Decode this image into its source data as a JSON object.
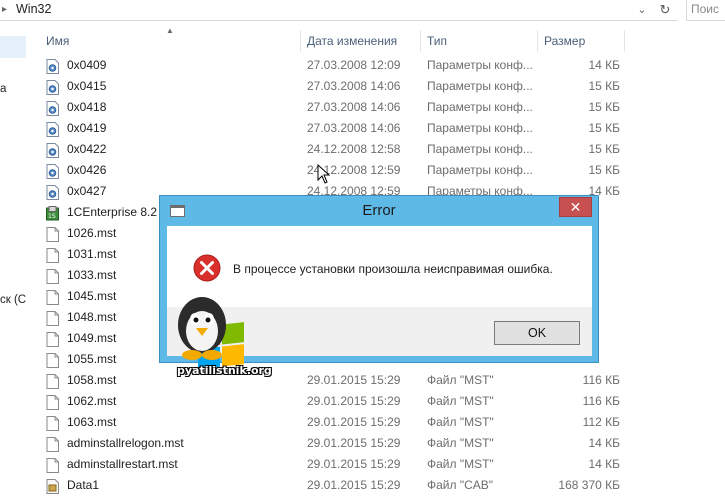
{
  "address_bar": {
    "path": "Win32",
    "search_placeholder": "Поис"
  },
  "nav": {
    "fragments": [
      "а",
      "ск (С"
    ]
  },
  "columns": {
    "name": "Имя",
    "date": "Дата изменения",
    "type": "Тип",
    "size": "Размер"
  },
  "files": [
    {
      "name": "0x0409",
      "date": "27.03.2008 12:09",
      "type": "Параметры конф...",
      "size": "14 КБ",
      "icon": "config-file-icon"
    },
    {
      "name": "0x0415",
      "date": "27.03.2008 14:06",
      "type": "Параметры конф...",
      "size": "15 КБ",
      "icon": "config-file-icon"
    },
    {
      "name": "0x0418",
      "date": "27.03.2008 14:06",
      "type": "Параметры конф...",
      "size": "15 КБ",
      "icon": "config-file-icon"
    },
    {
      "name": "0x0419",
      "date": "27.03.2008 14:06",
      "type": "Параметры конф...",
      "size": "15 КБ",
      "icon": "config-file-icon"
    },
    {
      "name": "0x0422",
      "date": "24.12.2008 12:58",
      "type": "Параметры конф...",
      "size": "15 КБ",
      "icon": "config-file-icon"
    },
    {
      "name": "0x0426",
      "date": "24.12.2008 12:59",
      "type": "Параметры конф...",
      "size": "15 КБ",
      "icon": "config-file-icon"
    },
    {
      "name": "0x0427",
      "date": "24.12.2008 12:59",
      "type": "Параметры конф...",
      "size": "14 КБ",
      "icon": "config-file-icon"
    },
    {
      "name": "1CEnterprise 8.2",
      "date": "",
      "type": "",
      "size": "",
      "icon": "installer-package-icon"
    },
    {
      "name": "1026.mst",
      "date": "",
      "type": "",
      "size": "",
      "icon": "document-icon"
    },
    {
      "name": "1031.mst",
      "date": "",
      "type": "",
      "size": "",
      "icon": "document-icon"
    },
    {
      "name": "1033.mst",
      "date": "",
      "type": "",
      "size": "",
      "icon": "document-icon"
    },
    {
      "name": "1045.mst",
      "date": "",
      "type": "",
      "size": "",
      "icon": "document-icon"
    },
    {
      "name": "1048.mst",
      "date": "",
      "type": "",
      "size": "",
      "icon": "document-icon"
    },
    {
      "name": "1049.mst",
      "date": "",
      "type": "",
      "size": "",
      "icon": "document-icon"
    },
    {
      "name": "1055.mst",
      "date": "",
      "type": "",
      "size": "",
      "icon": "document-icon"
    },
    {
      "name": "1058.mst",
      "date": "29.01.2015 15:29",
      "type": "Файл \"MST\"",
      "size": "116 КБ",
      "icon": "document-icon"
    },
    {
      "name": "1062.mst",
      "date": "29.01.2015 15:29",
      "type": "Файл \"MST\"",
      "size": "116 КБ",
      "icon": "document-icon"
    },
    {
      "name": "1063.mst",
      "date": "29.01.2015 15:29",
      "type": "Файл \"MST\"",
      "size": "112 КБ",
      "icon": "document-icon"
    },
    {
      "name": "adminstallrelogon.mst",
      "date": "29.01.2015 15:29",
      "type": "Файл \"MST\"",
      "size": "14 КБ",
      "icon": "document-icon"
    },
    {
      "name": "adminstallrestart.mst",
      "date": "29.01.2015 15:29",
      "type": "Файл \"MST\"",
      "size": "14 КБ",
      "icon": "document-icon"
    },
    {
      "name": "Data1",
      "date": "29.01.2015 15:29",
      "type": "Файл \"CAB\"",
      "size": "168 370 КБ",
      "icon": "cab-archive-icon"
    }
  ],
  "dialog": {
    "title": "Error",
    "message": "В процессе установки произошла неисправимая ошибка.",
    "ok_label": "OK",
    "close_glyph": "✕"
  },
  "watermark": {
    "text": "pyatilistnik.org"
  },
  "colors": {
    "dialog_frame": "#5fb9e6",
    "close_button": "#c75050",
    "error_red": "#d9302c",
    "header_text": "#4c607a"
  }
}
